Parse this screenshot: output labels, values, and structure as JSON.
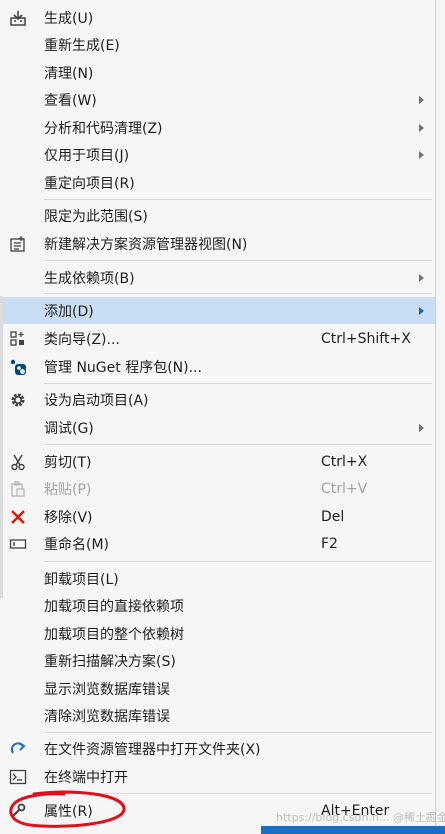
{
  "menu": {
    "items": [
      {
        "label": "生成(U)",
        "icon": "build-icon"
      },
      {
        "label": "重新生成(E)"
      },
      {
        "label": "清理(N)"
      },
      {
        "label": "查看(W)",
        "submenu": true
      },
      {
        "label": "分析和代码清理(Z)",
        "submenu": true
      },
      {
        "label": "仅用于项目(J)",
        "submenu": true
      },
      {
        "label": "重定向项目(R)"
      },
      {
        "label": "限定为此范围(S)"
      },
      {
        "label": "新建解决方案资源管理器视图(N)",
        "icon": "new-view-icon"
      },
      {
        "label": "生成依赖项(B)",
        "submenu": true
      },
      {
        "label": "添加(D)",
        "submenu": true,
        "highlighted": true
      },
      {
        "label": "类向导(Z)...",
        "shortcut": "Ctrl+Shift+X",
        "icon": "class-wizard-icon"
      },
      {
        "label": "管理 NuGet 程序包(N)...",
        "icon": "nuget-icon"
      },
      {
        "label": "设为启动项目(A)",
        "icon": "gear-icon"
      },
      {
        "label": "调试(G)",
        "submenu": true
      },
      {
        "label": "剪切(T)",
        "shortcut": "Ctrl+X",
        "icon": "scissors-icon"
      },
      {
        "label": "粘贴(P)",
        "shortcut": "Ctrl+V",
        "icon": "paste-icon",
        "disabled": true
      },
      {
        "label": "移除(V)",
        "shortcut": "Del",
        "icon": "remove-icon"
      },
      {
        "label": "重命名(M)",
        "shortcut": "F2",
        "icon": "rename-icon"
      },
      {
        "label": "卸载项目(L)"
      },
      {
        "label": "加载项目的直接依赖项"
      },
      {
        "label": "加载项目的整个依赖树"
      },
      {
        "label": "重新扫描解决方案(S)"
      },
      {
        "label": "显示浏览数据库错误"
      },
      {
        "label": "清除浏览数据库错误"
      },
      {
        "label": "在文件资源管理器中打开文件夹(X)",
        "icon": "open-folder-icon"
      },
      {
        "label": "在终端中打开",
        "icon": "terminal-icon"
      },
      {
        "label": "属性(R)",
        "shortcut": "Alt+Enter",
        "icon": "wrench-icon"
      }
    ]
  },
  "watermark": "https://blog.csdn.n... @稀土掘金技术社区",
  "colors": {
    "highlight": "#c9def5",
    "remove_red": "#e51400",
    "accent_blue": "#1b6ec2",
    "scribble_red": "#e0101a"
  }
}
